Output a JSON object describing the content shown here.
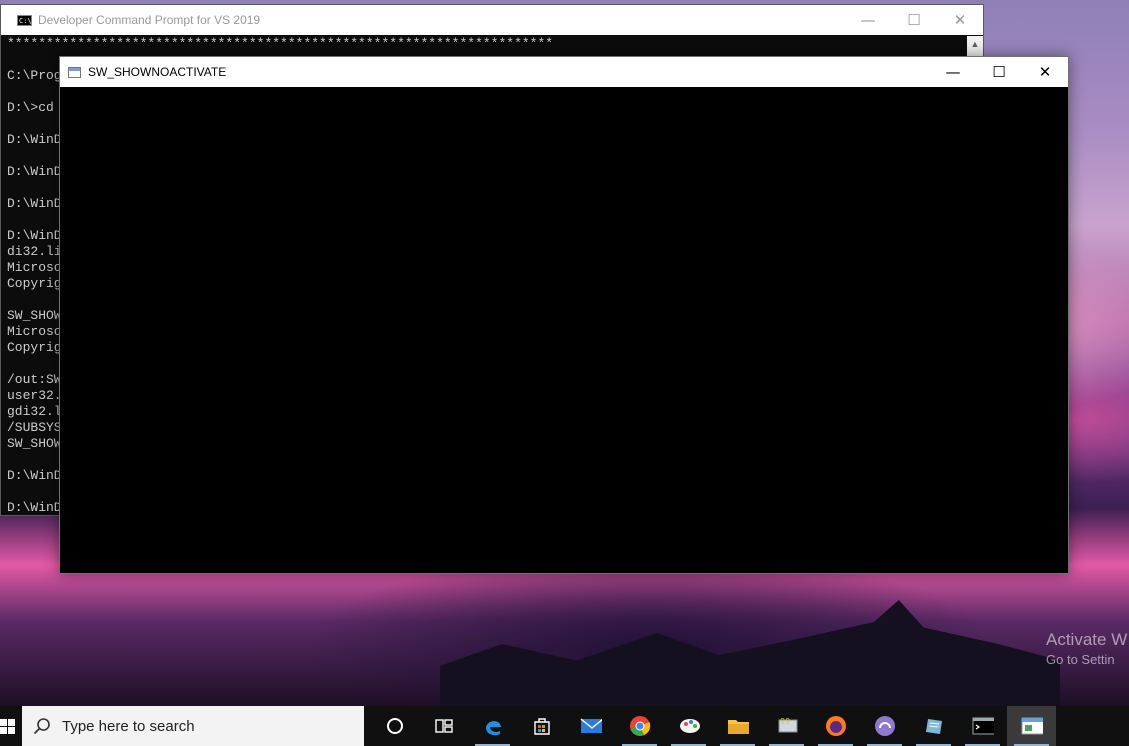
{
  "desktop": {
    "watermark_line1": "Activate W",
    "watermark_line2": "Go to Settin"
  },
  "cmd_window": {
    "title": "Developer Command Prompt for VS 2019",
    "icon_text": "C:\\",
    "controls": {
      "minimize": "—",
      "maximize": "☐",
      "close": "✕"
    },
    "lines": [
      "**********************************************************************",
      "",
      "C:\\Prog",
      "",
      "D:\\>cd",
      "",
      "D:\\WinD",
      "",
      "D:\\WinD",
      "",
      "D:\\WinD",
      "",
      "D:\\WinD",
      "di32.li",
      "Microso",
      "Copyrig",
      "",
      "SW_SHOW",
      "Microso",
      "Copyrig",
      "",
      "/out:SW",
      "user32.",
      "gdi32.l",
      "/SUBSYS",
      "SW_SHOW",
      "",
      "D:\\WinD",
      "",
      "D:\\WinD"
    ]
  },
  "app_window": {
    "title": "SW_SHOWNOACTIVATE",
    "controls": {
      "minimize": "—",
      "maximize": "☐",
      "close": "✕"
    }
  },
  "taskbar": {
    "search_placeholder": "Type here to search",
    "items": [
      {
        "name": "cortana",
        "icon": "circle-icon",
        "color": "#ffffff"
      },
      {
        "name": "task-view",
        "icon": "task-view-icon",
        "color": "#ffffff"
      },
      {
        "name": "edge",
        "icon": "edge-icon",
        "color": "#1f8fe6"
      },
      {
        "name": "store",
        "icon": "store-icon",
        "color": "#ffffff"
      },
      {
        "name": "mail",
        "icon": "mail-icon",
        "color": "#2b7bd8"
      },
      {
        "name": "chrome",
        "icon": "chrome-icon",
        "color": "#34a853"
      },
      {
        "name": "paint",
        "icon": "paint-icon",
        "color": "#e05050"
      },
      {
        "name": "file-explorer",
        "icon": "folder-icon",
        "color": "#f6c343"
      },
      {
        "name": "app-99",
        "icon": "monitor-99-icon",
        "color": "#d9c845"
      },
      {
        "name": "firefox",
        "icon": "firefox-icon",
        "color": "#ff7a1a"
      },
      {
        "name": "bittorrent",
        "icon": "bittorrent-icon",
        "color": "#8d7ad0"
      },
      {
        "name": "app-pad",
        "icon": "notepad-icon",
        "color": "#7fb7d9"
      },
      {
        "name": "command-prompt",
        "icon": "console-icon",
        "color": "#ffffff"
      },
      {
        "name": "sw-window",
        "icon": "window-app-icon",
        "color": "#ffffff"
      }
    ]
  }
}
